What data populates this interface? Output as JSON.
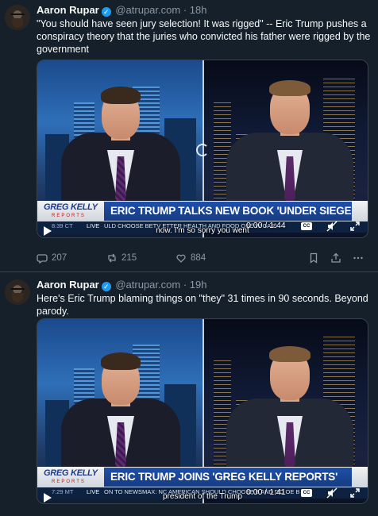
{
  "posts": [
    {
      "author_name": "Aaron Rupar",
      "handle": "@atrupar.com",
      "separator": "·",
      "time": "18h",
      "text": "\"You should have seen jury selection! It was rigged\" -- Eric Trump pushes a conspiracy theory that the juries who convicted his father were rigged by the government",
      "video": {
        "logo_main": "GREG KELLY",
        "logo_sub": "REPORTS",
        "headline": "ERIC TRUMP TALKS NEW BOOK 'UNDER SIEGE'",
        "ticker_time": "8:39 CT",
        "ticker_live": "LIVE",
        "ticker_scroll": "ULD CHOOSE BETV   ETTER HEALTH AND FOOD                            OSE    W     GARI",
        "caption": "now. I'm so sorry you went",
        "duration": "0:00 / 1:44",
        "cc_label": "CC",
        "progress": 0.0
      },
      "stats": {
        "replies": "207",
        "reposts": "215",
        "likes": "884"
      },
      "icons": [
        "reply-icon",
        "repost-icon",
        "like-icon",
        "bookmark-icon",
        "share-icon",
        "more-icon"
      ]
    },
    {
      "author_name": "Aaron Rupar",
      "handle": "@atrupar.com",
      "separator": "·",
      "time": "19h",
      "text": "Here's Eric Trump blaming things on \"they\" 31 times in 90 seconds. Beyond parody.",
      "video": {
        "logo_main": "GREG KELLY",
        "logo_sub": "REPORTS",
        "headline": "ERIC TRUMP JOINS 'GREG KELLY REPORTS'",
        "ticker_time": "7:29 MT",
        "ticker_live": "LIVE",
        "ticker_scroll": "ON TO NEWSMAX: NC   AMERICAN SHOULD CHOOSE B               AND     DO    OE B",
        "caption": "president of the Trump",
        "duration": "0:00 / 1:41",
        "cc_label": "CC",
        "progress": 0.0
      }
    }
  ],
  "colors": {
    "background": "#15202b",
    "accent": "#1d9bf0",
    "muted": "#8b98a5",
    "chyron_blue": "#1e4fa8"
  }
}
